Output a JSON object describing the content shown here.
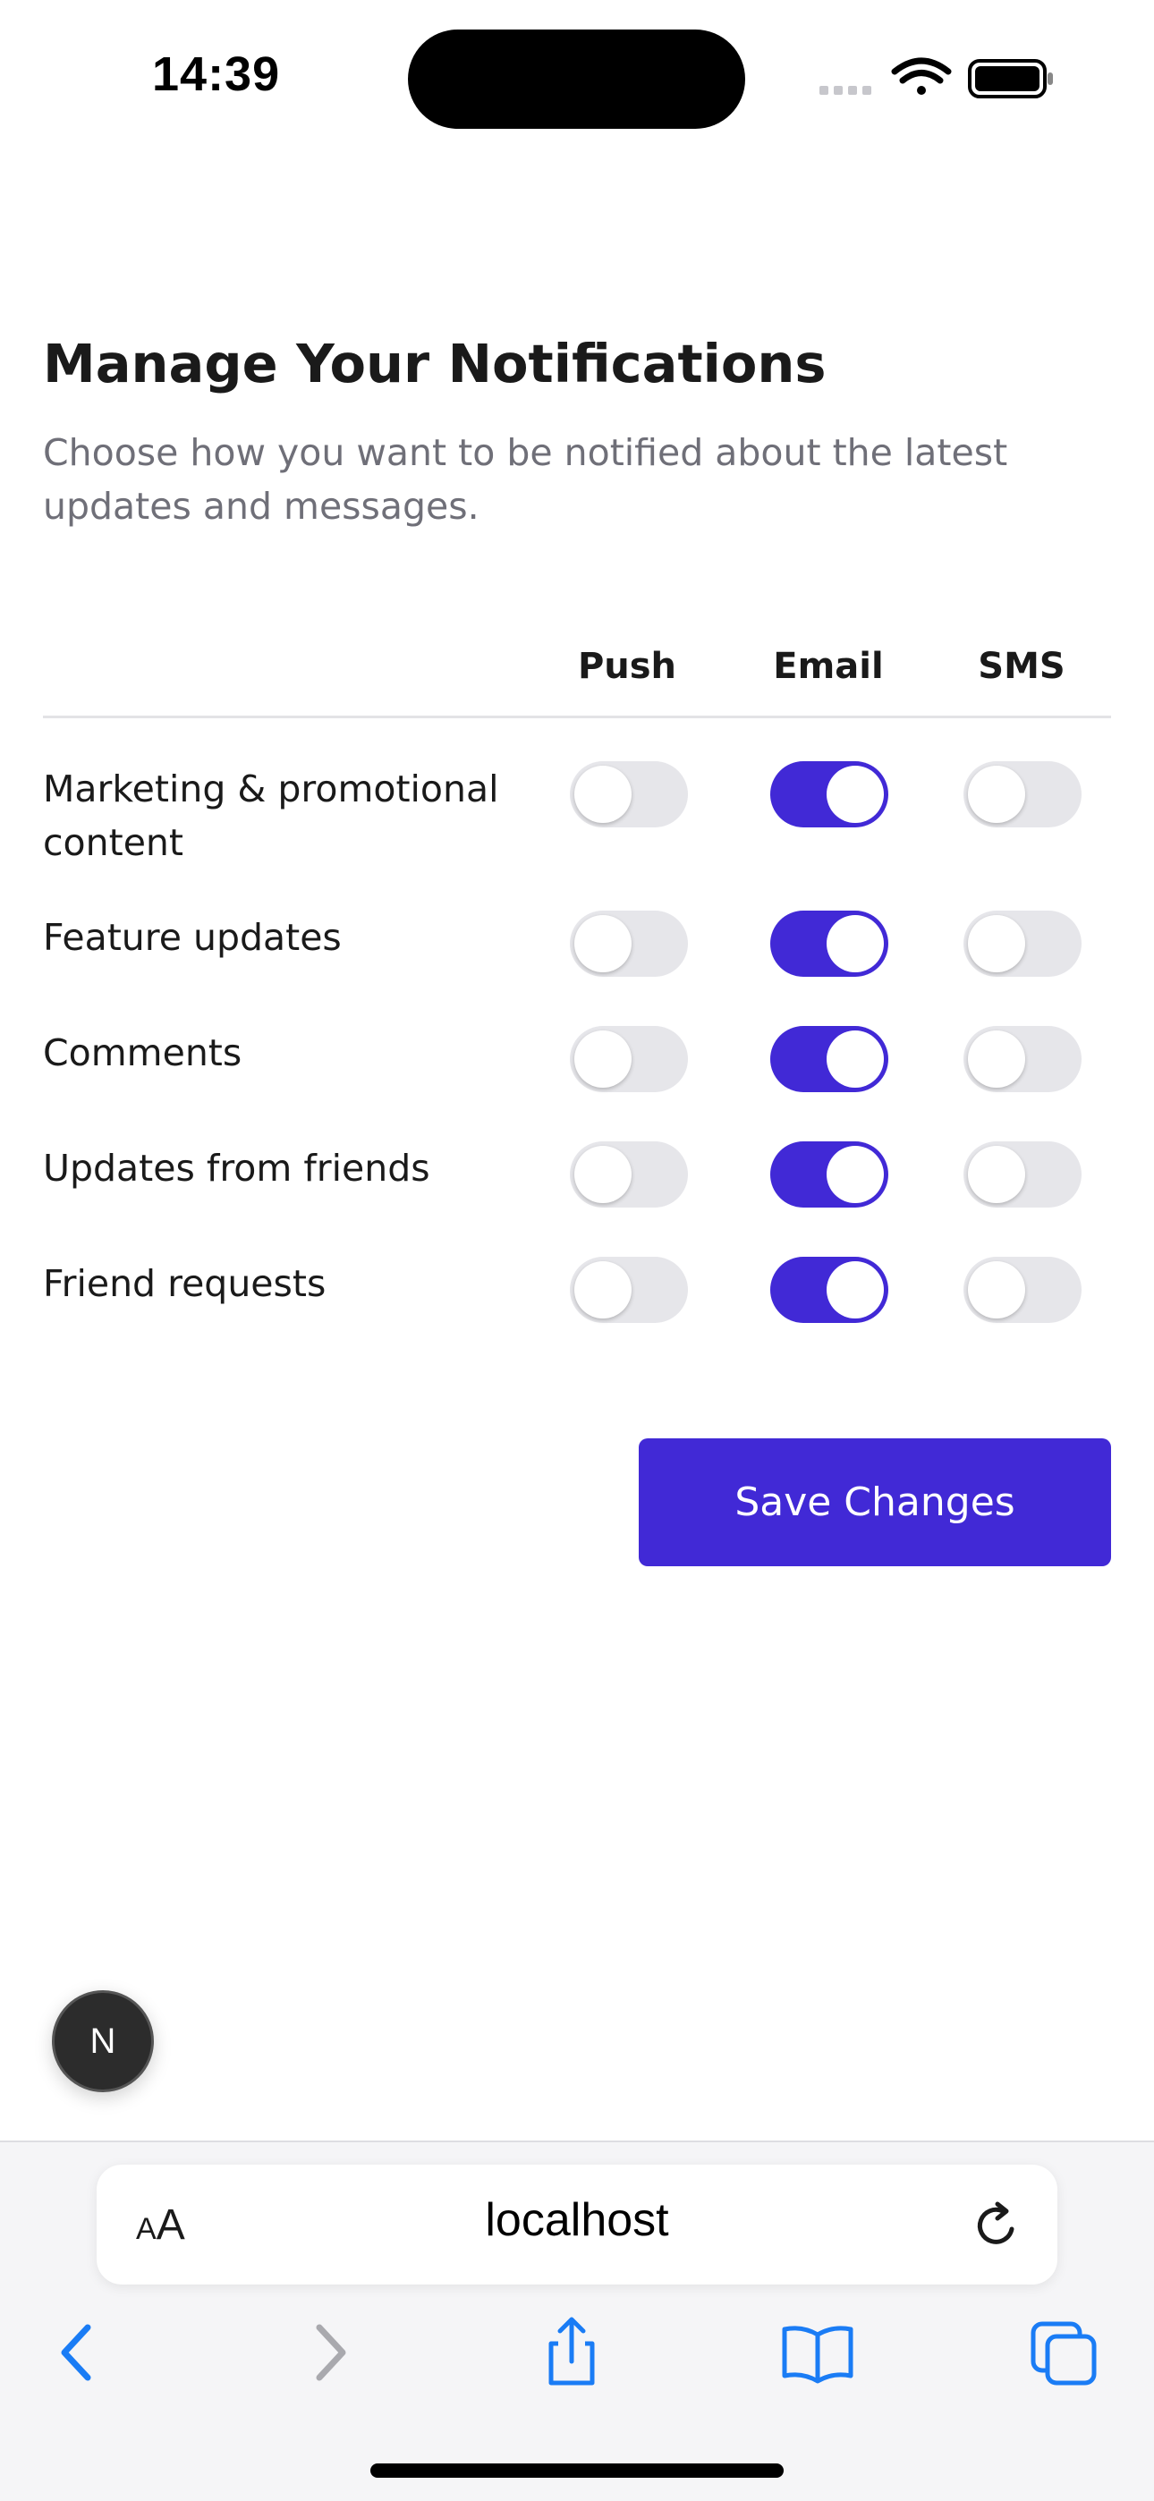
{
  "status_bar": {
    "time": "14:39"
  },
  "page": {
    "title": "Manage Your Notifications",
    "subtitle": "Choose how you want to be notified about the latest updates and messages."
  },
  "columns": [
    "Push",
    "Email",
    "SMS"
  ],
  "rows": [
    {
      "label": "Marketing & promotional content",
      "push": false,
      "email": true,
      "sms": false
    },
    {
      "label": "Feature updates",
      "push": false,
      "email": true,
      "sms": false
    },
    {
      "label": "Comments",
      "push": false,
      "email": true,
      "sms": false
    },
    {
      "label": "Updates from friends",
      "push": false,
      "email": true,
      "sms": false
    },
    {
      "label": "Friend requests",
      "push": false,
      "email": true,
      "sms": false
    }
  ],
  "actions": {
    "save_label": "Save Changes"
  },
  "dev_badge": {
    "letter": "N"
  },
  "browser": {
    "aa_small": "A",
    "aa_big": "A",
    "url": "localhost"
  },
  "colors": {
    "accent": "#4129d6",
    "toggle_off": "#e6e6ea",
    "ios_blue": "#1a7cf5"
  },
  "icons": [
    "wifi-icon",
    "battery-icon",
    "signal-icon",
    "reload-icon",
    "back-arrow-icon",
    "forward-arrow-icon",
    "share-icon",
    "bookmarks-icon",
    "tabs-icon"
  ]
}
